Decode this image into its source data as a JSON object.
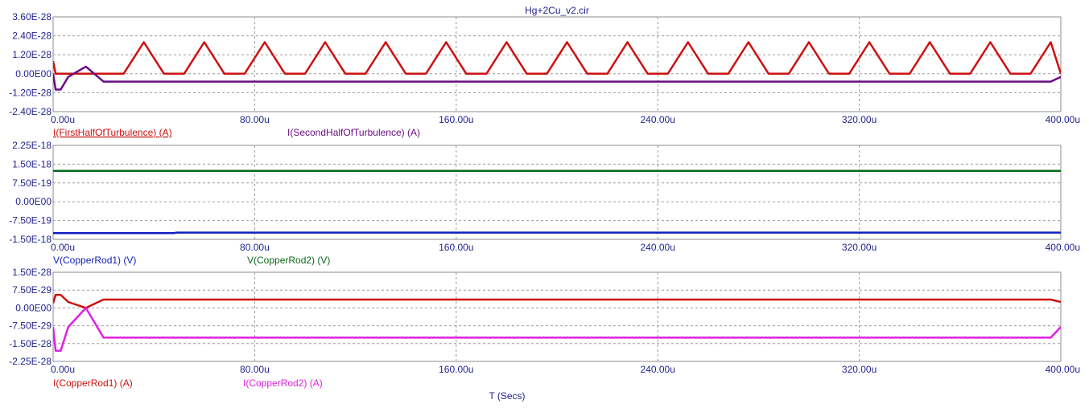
{
  "title": "Hg+2Cu_v2.cir",
  "x_axis_label": "T (Secs)",
  "x_ticks": [
    "0.00u",
    "80.00u",
    "160.00u",
    "240.00u",
    "320.00u",
    "400.00u"
  ],
  "chart_data": [
    {
      "type": "line",
      "xlim": [
        0,
        400
      ],
      "ylim": [
        -2.4e-28,
        3.6e-28
      ],
      "y_ticks": [
        "3.60E-28",
        "2.40E-28",
        "1.20E-28",
        "0.00E00",
        "-1.20E-28",
        "-2.40E-28"
      ],
      "x_ticks": [
        "0.00u",
        "80.00u",
        "160.00u",
        "240.00u",
        "320.00u",
        "400.00u"
      ],
      "grid": true,
      "series": [
        {
          "name": "I(FirstHalfOfTurbulence) (A)",
          "color": "#cc1111",
          "underline": true,
          "points": [
            [
              0,
              8e-29
            ],
            [
              1,
              0
            ],
            [
              20,
              0
            ],
            [
              28,
              0
            ],
            [
              36,
              2e-28
            ],
            [
              44,
              0
            ],
            [
              52,
              0
            ],
            [
              60,
              2e-28
            ],
            [
              68,
              0
            ],
            [
              76,
              0
            ],
            [
              84,
              2e-28
            ],
            [
              92,
              0
            ],
            [
              100,
              0
            ],
            [
              108,
              2e-28
            ],
            [
              116,
              0
            ],
            [
              124,
              0
            ],
            [
              132,
              2e-28
            ],
            [
              140,
              0
            ],
            [
              148,
              0
            ],
            [
              156,
              2e-28
            ],
            [
              164,
              0
            ],
            [
              172,
              0
            ],
            [
              180,
              2e-28
            ],
            [
              188,
              0
            ],
            [
              196,
              0
            ],
            [
              204,
              2e-28
            ],
            [
              212,
              0
            ],
            [
              220,
              0
            ],
            [
              228,
              2e-28
            ],
            [
              236,
              0
            ],
            [
              244,
              0
            ],
            [
              252,
              2e-28
            ],
            [
              260,
              0
            ],
            [
              268,
              0
            ],
            [
              276,
              2e-28
            ],
            [
              284,
              0
            ],
            [
              292,
              0
            ],
            [
              300,
              2e-28
            ],
            [
              308,
              0
            ],
            [
              316,
              0
            ],
            [
              324,
              2e-28
            ],
            [
              332,
              0
            ],
            [
              340,
              0
            ],
            [
              348,
              2e-28
            ],
            [
              356,
              0
            ],
            [
              364,
              0
            ],
            [
              372,
              2e-28
            ],
            [
              380,
              0
            ],
            [
              388,
              0
            ],
            [
              396,
              2e-28
            ],
            [
              400,
              0
            ]
          ]
        },
        {
          "name": "I(SecondHalfOfTurbulence) (A)",
          "color": "#6a0d83",
          "underline": false,
          "points": [
            [
              0,
              0
            ],
            [
              1,
              -1e-28
            ],
            [
              3,
              -1e-28
            ],
            [
              6,
              -2e-29
            ],
            [
              13,
              4.5e-29
            ],
            [
              20,
              -5e-29
            ],
            [
              396,
              -5e-29
            ],
            [
              400,
              -2e-29
            ]
          ]
        }
      ]
    },
    {
      "type": "line",
      "xlim": [
        0,
        400
      ],
      "ylim": [
        -1.5e-18,
        2.25e-18
      ],
      "y_ticks": [
        "2.25E-18",
        "1.50E-18",
        "7.50E-19",
        "0.00E00",
        "-7.50E-19",
        "-1.50E-18"
      ],
      "x_ticks": [
        "0.00u",
        "80.00u",
        "160.00u",
        "240.00u",
        "320.00u",
        "400.00u"
      ],
      "grid": true,
      "series": [
        {
          "name": "V(CopperRod1) (V)",
          "color": "#1020c0",
          "underline": false,
          "points": [
            [
              0,
              -1.25e-18
            ],
            [
              48,
              -1.25e-18
            ],
            [
              49,
              -1.23e-18
            ],
            [
              400,
              -1.23e-18
            ]
          ]
        },
        {
          "name": "V(CopperRod2) (V)",
          "color": "#0a6a1a",
          "underline": false,
          "points": [
            [
              0,
              1.23e-18
            ],
            [
              400,
              1.23e-18
            ]
          ]
        }
      ]
    },
    {
      "type": "line",
      "xlim": [
        0,
        400
      ],
      "ylim": [
        -2.25e-28,
        1.5e-28
      ],
      "y_ticks": [
        "1.50E-28",
        "7.50E-29",
        "0.00E00",
        "-7.50E-29",
        "-1.50E-28",
        "-2.25E-28"
      ],
      "x_ticks": [
        "0.00u",
        "80.00u",
        "160.00u",
        "240.00u",
        "320.00u",
        "400.00u"
      ],
      "grid": true,
      "series": [
        {
          "name": "I(CopperRod1) (A)",
          "color": "#cc1111",
          "underline": false,
          "points": [
            [
              0,
              2e-29
            ],
            [
              1,
              5.5e-29
            ],
            [
              3,
              5.5e-29
            ],
            [
              6,
              2.5e-29
            ],
            [
              13,
              0
            ],
            [
              20,
              3.5e-29
            ],
            [
              396,
              3.5e-29
            ],
            [
              400,
              2.5e-29
            ]
          ]
        },
        {
          "name": "I(CopperRod2) (A)",
          "color": "#e020e0",
          "underline": false,
          "points": [
            [
              0,
              -8e-29
            ],
            [
              1,
              -1.8e-28
            ],
            [
              3,
              -1.8e-28
            ],
            [
              6,
              -8e-29
            ],
            [
              13,
              0
            ],
            [
              20,
              -1.25e-28
            ],
            [
              396,
              -1.25e-28
            ],
            [
              400,
              -8e-29
            ]
          ]
        }
      ]
    }
  ]
}
